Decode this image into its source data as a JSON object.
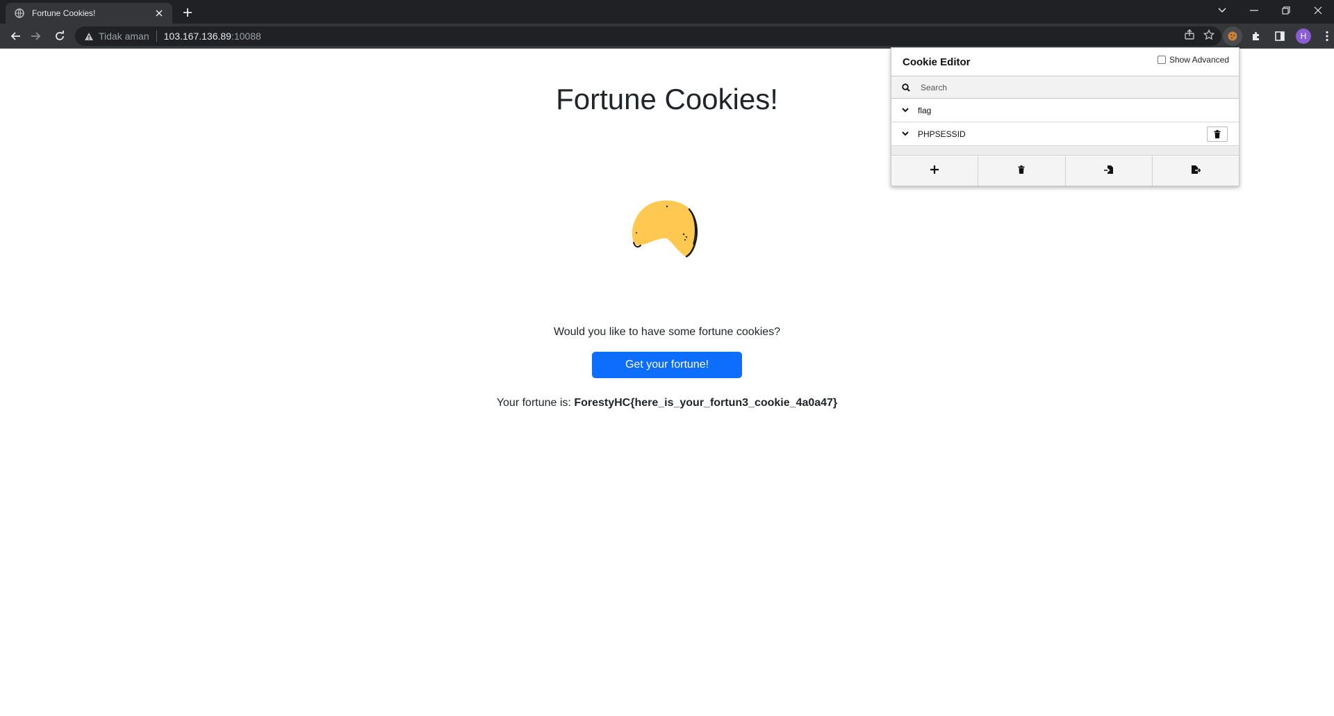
{
  "browser": {
    "tab_title": "Fortune Cookies!",
    "security_label": "Tidak aman",
    "url_host": "103.167.136.89",
    "url_port": ":10088",
    "profile_initial": "H"
  },
  "page": {
    "title": "Fortune Cookies!",
    "prompt": "Would you like to have some fortune cookies?",
    "button_label": "Get your fortune!",
    "fortune_prefix": "Your fortune is: ",
    "fortune_value": "ForestyHC{here_is_your_fortun3_cookie_4a0a47}"
  },
  "cookie_editor": {
    "title": "Cookie Editor",
    "show_advanced_label": "Show Advanced",
    "show_advanced_checked": false,
    "search_placeholder": "Search",
    "cookies": [
      {
        "name": "flag"
      },
      {
        "name": "PHPSESSID"
      }
    ]
  },
  "colors": {
    "accent": "#0d6efd",
    "cookie": "#ffc850",
    "chrome_dark": "#202124",
    "chrome_mid": "#35363a"
  }
}
